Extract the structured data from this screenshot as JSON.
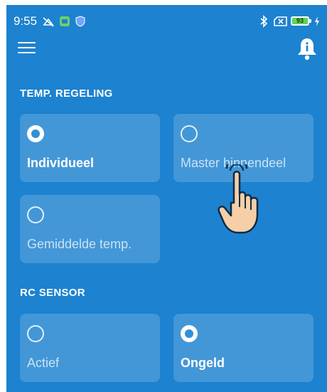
{
  "statusbar": {
    "time": "9:55",
    "battery_level": "93"
  },
  "icons": {
    "menu": "menu-icon",
    "notification": "bell-info-icon"
  },
  "temp_section": {
    "title": "TEMP. REGELING",
    "options": [
      {
        "label": "Individueel",
        "selected": true
      },
      {
        "label": "Master binnendeel",
        "selected": false
      },
      {
        "label": "Gemiddelde temp.",
        "selected": false
      }
    ]
  },
  "rc_section": {
    "title": "RC SENSOR",
    "options": [
      {
        "label": "Actief",
        "selected": false
      },
      {
        "label": "Ongeld",
        "selected": true
      }
    ]
  },
  "colors": {
    "background": "#1d82cf",
    "card": "rgba(255,255,255,0.17)",
    "radio_dot": "#2f8fd8"
  }
}
